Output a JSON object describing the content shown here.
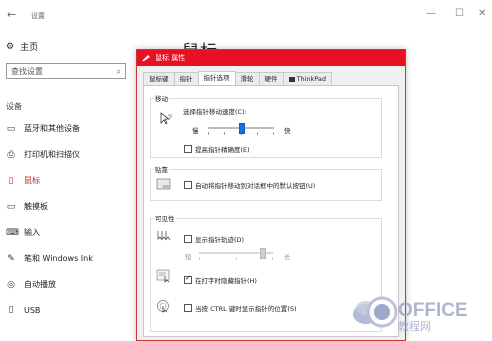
{
  "window": {
    "title": "设置"
  },
  "nav": {
    "home": "主页",
    "search_placeholder": "查找设置",
    "section": "设备",
    "items": [
      {
        "label": "蓝牙和其他设备",
        "icon": "bluetooth-icon"
      },
      {
        "label": "打印机和扫描仪",
        "icon": "printer-icon"
      },
      {
        "label": "鼠标",
        "icon": "mouse-icon",
        "active": true
      },
      {
        "label": "触摸板",
        "icon": "touchpad-icon"
      },
      {
        "label": "输入",
        "icon": "keyboard-icon"
      },
      {
        "label": "笔和 Windows Ink",
        "icon": "pen-icon"
      },
      {
        "label": "自动播放",
        "icon": "autoplay-icon"
      },
      {
        "label": "USB",
        "icon": "usb-icon"
      }
    ]
  },
  "page": {
    "title": "鼠标"
  },
  "dialog": {
    "title": "鼠标 属性",
    "tabs": [
      "鼠标键",
      "指针",
      "指针选项",
      "滑轮",
      "硬件",
      "ThinkPad"
    ],
    "active_tab": 2,
    "motion": {
      "label": "移动",
      "speed_label": "选择指针移动速度(C):",
      "slow": "慢",
      "fast": "快",
      "speed_value": 0.5,
      "precision_label": "提高指针精确度(E)",
      "precision_checked": false
    },
    "snap": {
      "label": "贴靠",
      "snap_label": "自动将指针移动到对话框中的默认按钮(U)",
      "snap_checked": false
    },
    "visibility": {
      "label": "可见性",
      "trails_label": "显示指针轨迹(D)",
      "trails_checked": false,
      "short": "短",
      "long": "长",
      "trails_value": 0.85,
      "hide_label": "在打字时隐藏指针(H)",
      "hide_checked": true,
      "ctrl_label": "当按 CTRL 键时显示指针的位置(S)",
      "ctrl_checked": false
    }
  },
  "watermark": {
    "text": "OFFICE教程网"
  },
  "colors": {
    "accent": "#e81123",
    "active_nav": "#c4282d",
    "thumb": "#1e6fd9"
  }
}
